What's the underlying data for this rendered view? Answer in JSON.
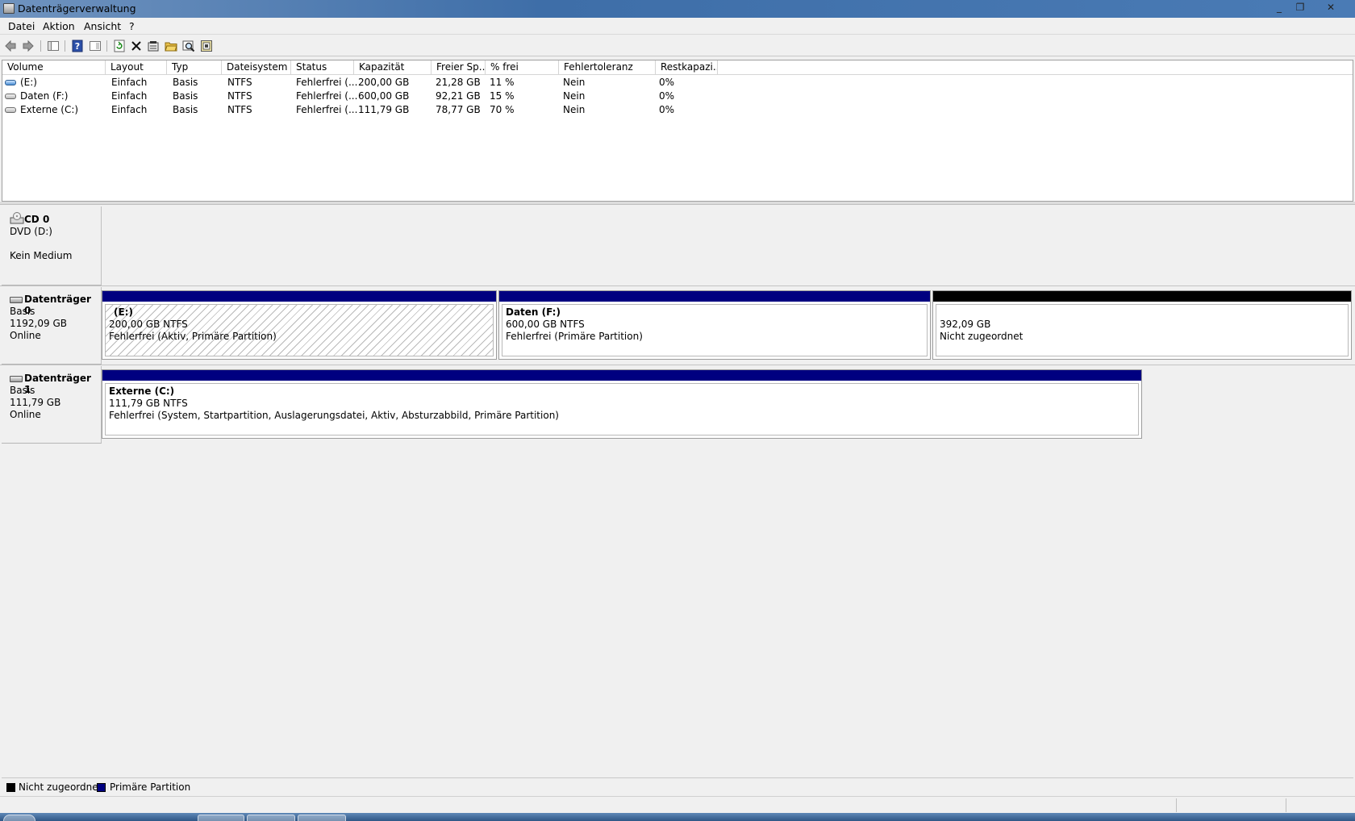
{
  "window": {
    "title": "Datenträgerverwaltung",
    "controls": {
      "minimize": "_",
      "restore": "❐",
      "close": "✕"
    }
  },
  "menu": [
    "Datei",
    "Aktion",
    "Ansicht",
    "?"
  ],
  "toolbar": {
    "icons": [
      "back-icon",
      "forward-icon",
      "console-tree-icon",
      "help-icon",
      "show-pane-icon",
      "refresh-icon",
      "delete-icon",
      "properties-icon",
      "open-icon",
      "explore-icon",
      "settings-icon"
    ]
  },
  "volume_list": {
    "columns": [
      "Volume",
      "Layout",
      "Typ",
      "Dateisystem",
      "Status",
      "Kapazität",
      "Freier Sp...",
      "% frei",
      "Fehlertoleranz",
      "Restkapazi..."
    ],
    "rows": [
      {
        "icon": "blue",
        "volume": "(E:)",
        "layout": "Einfach",
        "typ": "Basis",
        "fs": "NTFS",
        "status": "Fehlerfrei (...",
        "kap": "200,00 GB",
        "frei": "21,28 GB",
        "pct": "11 %",
        "ft": "Nein",
        "rest": "0%"
      },
      {
        "icon": "gray",
        "volume": "Daten (F:)",
        "layout": "Einfach",
        "typ": "Basis",
        "fs": "NTFS",
        "status": "Fehlerfrei (...",
        "kap": "600,00 GB",
        "frei": "92,21 GB",
        "pct": "15 %",
        "ft": "Nein",
        "rest": "0%"
      },
      {
        "icon": "gray",
        "volume": "Externe (C:)",
        "layout": "Einfach",
        "typ": "Basis",
        "fs": "NTFS",
        "status": "Fehlerfrei (...",
        "kap": "111,79 GB",
        "frei": "78,77 GB",
        "pct": "70 %",
        "ft": "Nein",
        "rest": "0%"
      }
    ]
  },
  "disks": {
    "cd0": {
      "name": "CD 0",
      "line1": "DVD (D:)",
      "line2": "Kein Medium"
    },
    "disk0": {
      "name": "Datenträger 0",
      "line1": "Basis",
      "line2": "1192,09 GB",
      "line3": "Online",
      "partitions": [
        {
          "title": "(E:)",
          "size": "200,00 GB NTFS",
          "status": "Fehlerfrei (Aktiv, Primäre Partition)"
        },
        {
          "title": "Daten  (F:)",
          "size": "600,00 GB NTFS",
          "status": "Fehlerfrei (Primäre Partition)"
        },
        {
          "title": "",
          "size": "392,09 GB",
          "status": "Nicht zugeordnet"
        }
      ]
    },
    "disk1": {
      "name": "Datenträger 1",
      "line1": "Basis",
      "line2": "111,79 GB",
      "line3": "Online",
      "partitions": [
        {
          "title": "Externe  (C:)",
          "size": "111,79 GB NTFS",
          "status": "Fehlerfrei (System, Startpartition, Auslagerungsdatei, Aktiv, Absturzabbild, Primäre Partition)"
        }
      ]
    }
  },
  "legend": [
    {
      "label": "Nicht zugeordnet",
      "color": "#000000"
    },
    {
      "label": "Primäre Partition",
      "color": "#000080"
    }
  ],
  "colors": {
    "primary": "#000080",
    "unallocated": "#000000"
  }
}
